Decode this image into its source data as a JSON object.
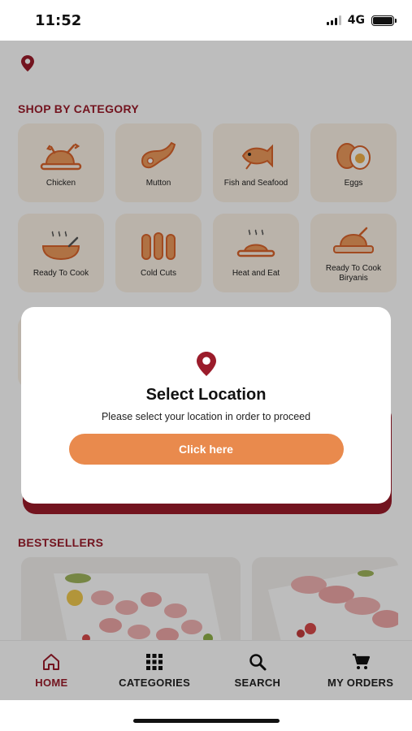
{
  "status_bar": {
    "time": "11:52",
    "network": "4G"
  },
  "header": {
    "icon": "location-pin-icon"
  },
  "categories_section": {
    "title": "SHOP BY CATEGORY",
    "items": [
      {
        "label": "Chicken",
        "icon": "chicken-icon"
      },
      {
        "label": "Mutton",
        "icon": "mutton-icon"
      },
      {
        "label": "Fish and Seafood",
        "icon": "fish-icon"
      },
      {
        "label": "Eggs",
        "icon": "eggs-icon"
      },
      {
        "label": "Ready To Cook",
        "icon": "cooking-pot-icon"
      },
      {
        "label": "Cold Cuts",
        "icon": "sausage-icon"
      },
      {
        "label": "Heat and Eat",
        "icon": "heat-eat-icon"
      },
      {
        "label": "Ready To Cook Biryanis",
        "icon": "biryani-icon"
      }
    ]
  },
  "bestsellers": {
    "title": "BESTSELLERS"
  },
  "modal": {
    "title": "Select Location",
    "subtitle": "Please select your location in order to proceed",
    "button_label": "Click here",
    "icon": "location-pin-icon"
  },
  "bottom_nav": {
    "items": [
      {
        "label": "HOME",
        "icon": "home-icon",
        "active": true
      },
      {
        "label": "CATEGORIES",
        "icon": "grid-icon",
        "active": false
      },
      {
        "label": "SEARCH",
        "icon": "search-icon",
        "active": false
      },
      {
        "label": "MY ORDERS",
        "icon": "cart-icon",
        "active": false
      }
    ]
  },
  "colors": {
    "brand": "#9b1c2b",
    "accent": "#e98a4d",
    "tile_bg": "#fbf2e6",
    "icon_orange": "#d9642c"
  }
}
